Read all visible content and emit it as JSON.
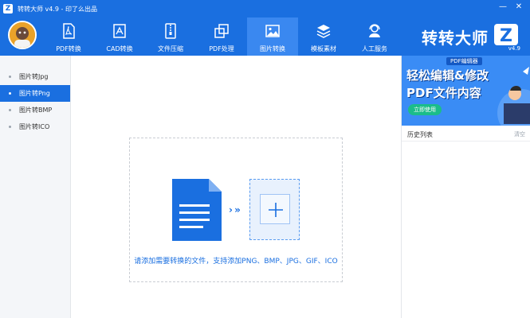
{
  "window": {
    "app_icon_letter": "Z",
    "title": "转转大师 v4.9 - 印了么出品",
    "minimize": "—",
    "close": "✕"
  },
  "nav": {
    "items": [
      {
        "label": "PDF转换",
        "icon": "pdf-file-icon"
      },
      {
        "label": "CAD转换",
        "icon": "cad-icon"
      },
      {
        "label": "文件压缩",
        "icon": "zip-icon"
      },
      {
        "label": "PDF处理",
        "icon": "pdf-process-icon"
      },
      {
        "label": "图片转换",
        "icon": "image-icon",
        "active": true
      },
      {
        "label": "模板素材",
        "icon": "layers-icon"
      },
      {
        "label": "人工服务",
        "icon": "support-agent-icon"
      }
    ]
  },
  "brand": {
    "name": "转转大师",
    "badge_letter": "Z",
    "version": "v4.9"
  },
  "sidebar": {
    "items": [
      {
        "label": "图片转Jpg"
      },
      {
        "label": "图片转Png",
        "active": true
      },
      {
        "label": "图片转BMP"
      },
      {
        "label": "图片转ICO"
      }
    ]
  },
  "main": {
    "arrows": "› »",
    "hint": "请添加需要转换的文件，支持添加PNG、BMP、JPG、GIF、ICO"
  },
  "ad": {
    "tag": "PDF编辑器",
    "line1": "轻松编辑&修改",
    "line2": "PDF文件内容",
    "button": "立即使用"
  },
  "history": {
    "title": "历史列表",
    "clear": "清空"
  },
  "colors": {
    "primary": "#1a6fe0",
    "nav_active": "#3a88f0",
    "ad_bg": "#3a8cf5",
    "ad_button": "#1bbd8a"
  }
}
